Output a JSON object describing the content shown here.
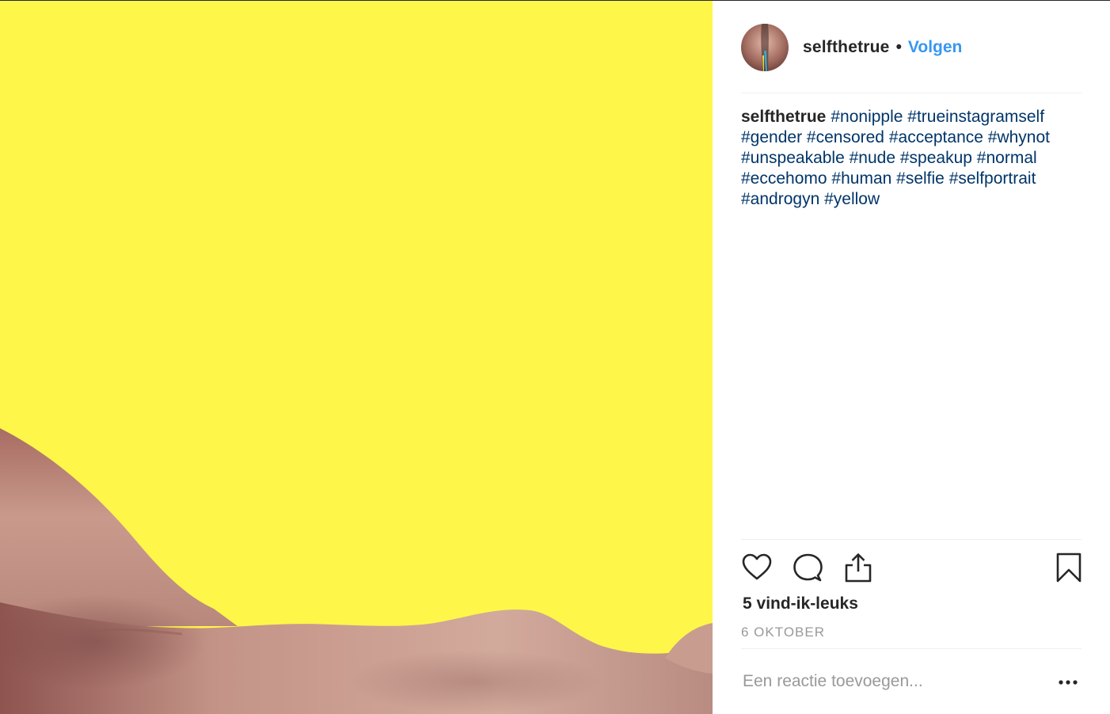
{
  "post": {
    "username": "selfthetrue",
    "separator": "•",
    "follow_label": "Volgen",
    "caption_user": "selfthetrue",
    "hashtags": [
      "#nonipple",
      "#trueinstagramself",
      "#gender",
      "#censored",
      "#acceptance",
      "#whynot",
      "#unspeakable",
      "#nude",
      "#speakup",
      "#normal",
      "#eccehomo",
      "#human",
      "#selfie",
      "#selfportrait",
      "#androgyn",
      "#yellow"
    ],
    "likes_text": "5 vind-ik-leuks",
    "date_text": "6 OKTOBER",
    "comment_placeholder": "Een reactie toevoegen..."
  },
  "icons": {
    "like": "heart-icon",
    "comment": "speech-bubble-icon",
    "share": "share-upload-icon",
    "save": "bookmark-icon",
    "more": "more-options-icon"
  },
  "colors": {
    "background_yellow": "#fff64a",
    "skin": "#c08d7f",
    "link_blue": "#3897f0",
    "hashtag_blue": "#003569",
    "text_dark": "#262626",
    "text_muted": "#999999"
  }
}
